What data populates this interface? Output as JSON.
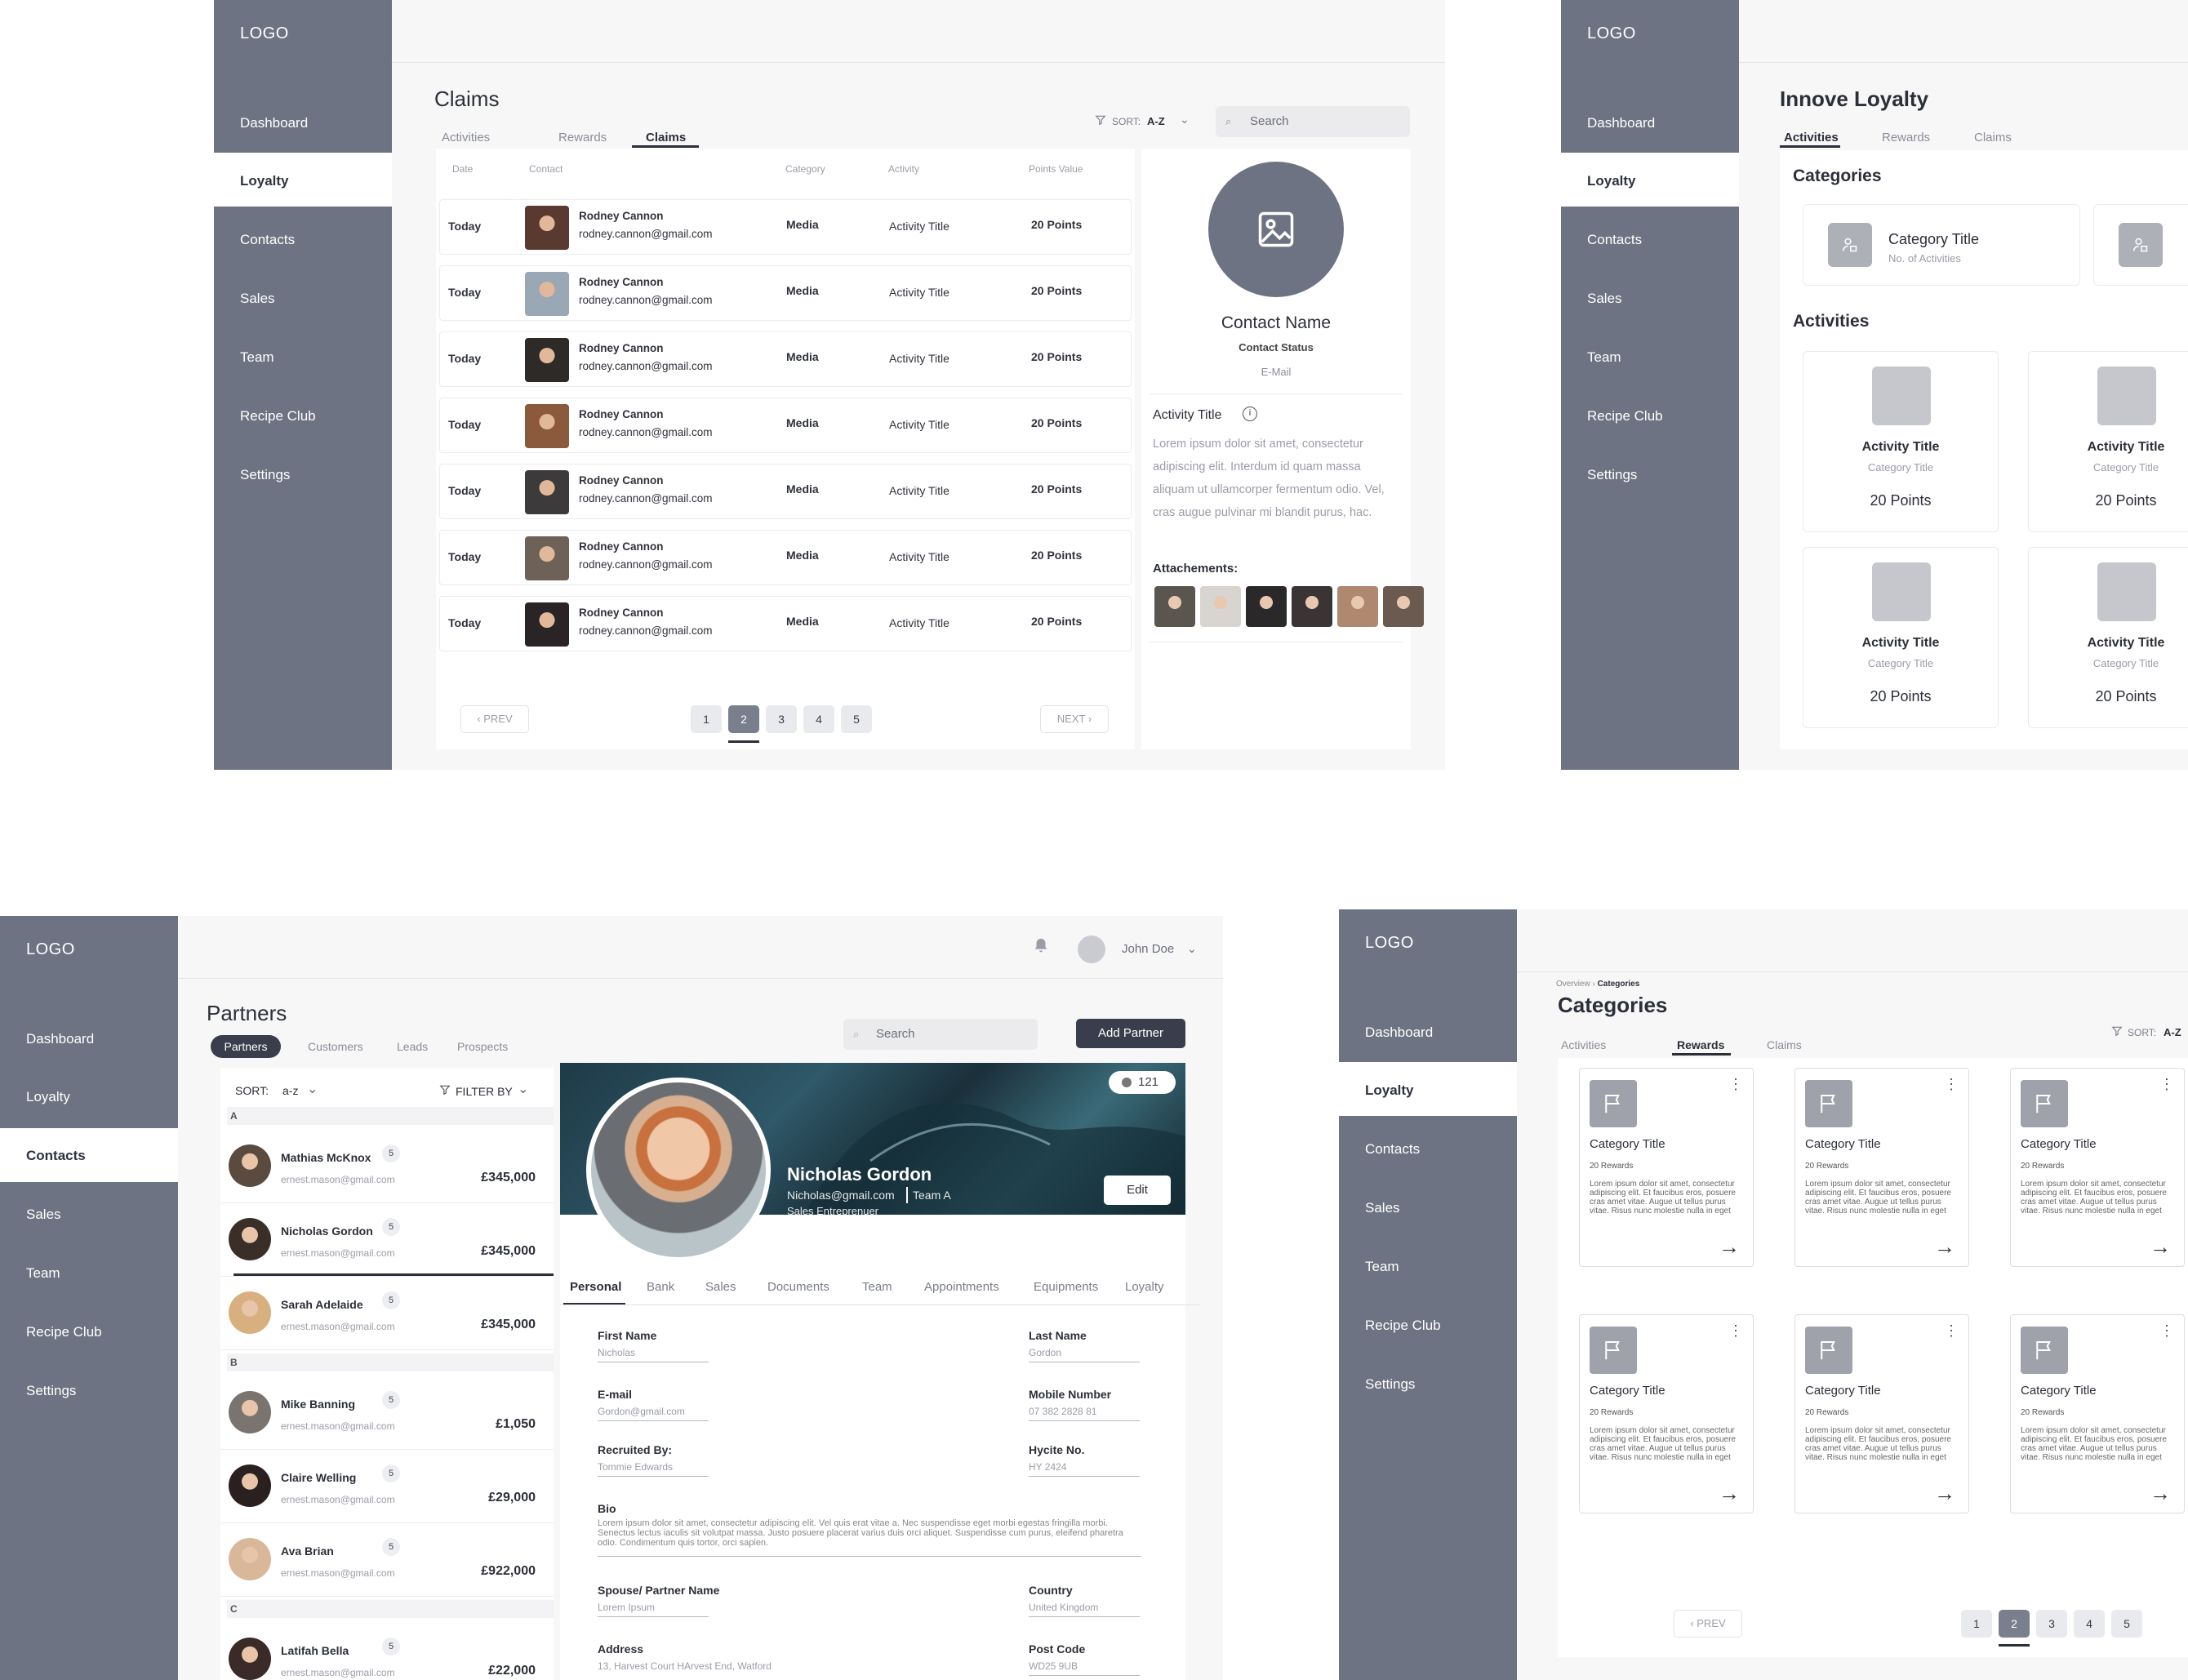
{
  "logo": "LOGO",
  "nav": [
    "Dashboard",
    "Loyalty",
    "Contacts",
    "Sales",
    "Team",
    "Recipe Club",
    "Settings"
  ],
  "user_name": "John Doe",
  "claims": {
    "title": "Claims",
    "tabs": [
      "Activities",
      "Rewards",
      "Claims"
    ],
    "sort_label": "SORT:",
    "sort_value": "A-Z",
    "search_placeholder": "Search",
    "columns": [
      "Date",
      "Contact",
      "Category",
      "Activity",
      "Points Value"
    ],
    "rows": [
      {
        "date": "Today",
        "name": "Rodney Cannon",
        "email": "rodney.cannon@gmail.com",
        "category": "Media",
        "activity": "Activity Title",
        "points": "20 Points"
      },
      {
        "date": "Today",
        "name": "Rodney Cannon",
        "email": "rodney.cannon@gmail.com",
        "category": "Media",
        "activity": "Activity Title",
        "points": "20 Points"
      },
      {
        "date": "Today",
        "name": "Rodney Cannon",
        "email": "rodney.cannon@gmail.com",
        "category": "Media",
        "activity": "Activity Title",
        "points": "20 Points"
      },
      {
        "date": "Today",
        "name": "Rodney Cannon",
        "email": "rodney.cannon@gmail.com",
        "category": "Media",
        "activity": "Activity Title",
        "points": "20 Points"
      },
      {
        "date": "Today",
        "name": "Rodney Cannon",
        "email": "rodney.cannon@gmail.com",
        "category": "Media",
        "activity": "Activity Title",
        "points": "20 Points"
      },
      {
        "date": "Today",
        "name": "Rodney Cannon",
        "email": "rodney.cannon@gmail.com",
        "category": "Media",
        "activity": "Activity Title",
        "points": "20 Points"
      },
      {
        "date": "Today",
        "name": "Rodney Cannon",
        "email": "rodney.cannon@gmail.com",
        "category": "Media",
        "activity": "Activity Title",
        "points": "20 Points"
      }
    ],
    "pages": [
      "1",
      "2",
      "3",
      "4",
      "5"
    ],
    "current_page": "2",
    "prev": "PREV",
    "next": "NEXT",
    "detail": {
      "contact_name": "Contact Name",
      "contact_status": "Contact Status",
      "email": "E-Mail",
      "activity_title": "Activity Title",
      "description": "Lorem ipsum dolor sit amet, consectetur adipiscing elit. Interdum id quam massa aliquam ut ullamcorper fermentum odio. Vel, cras augue pulvinar mi blandit purus, hac.",
      "attachments_label": "Attachements:"
    }
  },
  "loyalty": {
    "title": "Innove Loyalty",
    "tabs": [
      "Activities",
      "Rewards",
      "Claims"
    ],
    "categories_heading": "Categories",
    "category_title": "Category Title",
    "category_sub": "No. of Activities",
    "activities_heading": "Activities",
    "activities": [
      {
        "title": "Activity Title",
        "category": "Category Title",
        "points": "20 Points"
      },
      {
        "title": "Activity Title",
        "category": "Category Title",
        "points": "20 Points"
      },
      {
        "title": "Activity Title",
        "category": "Category Title",
        "points": "20 Points"
      },
      {
        "title": "Activity Title",
        "category": "Category Title",
        "points": "20 Points"
      }
    ]
  },
  "partners": {
    "title": "Partners",
    "tabs": [
      "Partners",
      "Customers",
      "Leads",
      "Prospects"
    ],
    "search_placeholder": "Search",
    "add_button": "Add Partner",
    "sort_label": "SORT:",
    "sort_value": "a-z",
    "filter_label": "FILTER BY",
    "groups": [
      {
        "letter": "A",
        "items": [
          {
            "name": "Mathias McKnox",
            "email": "ernest.mason@gmail.com",
            "count": "5",
            "amount": "£345,000"
          },
          {
            "name": "Nicholas Gordon",
            "email": "ernest.mason@gmail.com",
            "count": "5",
            "amount": "£345,000"
          },
          {
            "name": "Sarah Adelaide",
            "email": "ernest.mason@gmail.com",
            "count": "5",
            "amount": "£345,000"
          }
        ]
      },
      {
        "letter": "B",
        "items": [
          {
            "name": "Mike Banning",
            "email": "ernest.mason@gmail.com",
            "count": "5",
            "amount": "£1,050"
          },
          {
            "name": "Claire Welling",
            "email": "ernest.mason@gmail.com",
            "count": "5",
            "amount": "£29,000"
          },
          {
            "name": "Ava Brian",
            "email": "ernest.mason@gmail.com",
            "count": "5",
            "amount": "£922,000"
          }
        ]
      },
      {
        "letter": "C",
        "items": [
          {
            "name": "Latifah Bella",
            "email": "ernest.mason@gmail.com",
            "count": "5",
            "amount": "£22,000"
          }
        ]
      }
    ],
    "profile": {
      "count": "121",
      "name": "Nicholas Gordon",
      "email": "Nicholas@gmail.com",
      "team": "Team A",
      "role": "Sales Entreprenuer",
      "edit": "Edit",
      "tabs": [
        "Personal",
        "Bank",
        "Sales",
        "Documents",
        "Team",
        "Appointments",
        "Equipments",
        "Loyalty"
      ],
      "fields": {
        "first_name_label": "First Name",
        "first_name": "Nicholas",
        "last_name_label": "Last Name",
        "last_name": "Gordon",
        "email_label": "E-mail",
        "email": "Gordon@gmail.com",
        "mobile_label": "Mobile Number",
        "mobile": "07 382 2828 81",
        "recruited_label": "Recruited By:",
        "recruited": "Tommie Edwards",
        "hycite_label": "Hycite No.",
        "hycite": "HY 2424",
        "bio_label": "Bio",
        "bio": "Lorem ipsum dolor sit amet, consectetur adipiscing elit. Vel quis erat vitae a. Nec suspendisse eget morbi egestas fringilla morbi. Senectus lectus iaculis sit volutpat massa. Justo posuere placerat varius duis orci aliquet. Suspendisse cum purus, eleifend pharetra odio. Condimentum quis tortor, orci sapien.",
        "spouse_label": "Spouse/ Partner Name",
        "spouse": "Lorem Ipsum",
        "country_label": "Country",
        "country": "United Kingdom",
        "address_label": "Address",
        "address": "13, Harvest Court HArvest End, Watford",
        "postcode_label": "Post Code",
        "postcode": "WD25 9UB"
      }
    }
  },
  "categories": {
    "breadcrumb_root": "Overview",
    "breadcrumb_current": "Categories",
    "title": "Categories",
    "tabs": [
      "Activities",
      "Rewards",
      "Claims"
    ],
    "sort_label": "SORT:",
    "sort_value": "A-Z",
    "card_title": "Category Title",
    "card_sub": "20 Rewards",
    "card_text": "Lorem ipsum dolor sit amet, consectetur adipiscing elit. Et faucibus eros, posuere cras amet vitae. Augue ut tellus purus vitae. Risus nunc molestie nulla in eget",
    "pages": [
      "1",
      "2",
      "3",
      "4",
      "5"
    ],
    "prev": "PREV"
  },
  "colors": {
    "sidebar": "#6e7383",
    "accent": "#2c2f38",
    "page_active": "#7a7f8d"
  }
}
